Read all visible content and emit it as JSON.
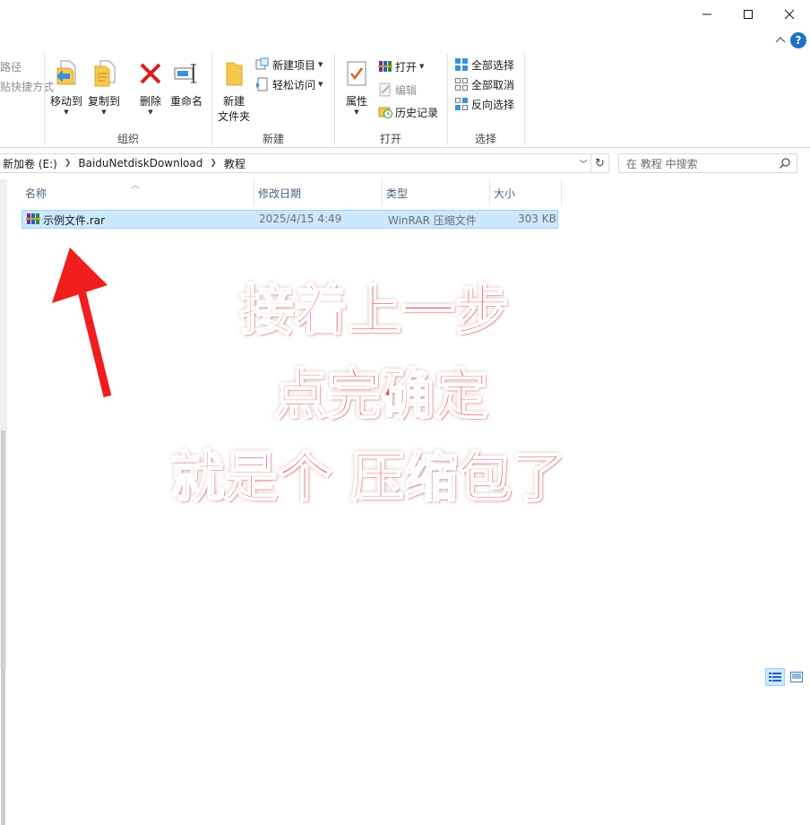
{
  "window": {
    "minimize": "minimize",
    "maximize": "maximize",
    "close": "close"
  },
  "ribbon": {
    "cut_partial_1": "路径",
    "cut_partial_2": "贴快捷方式",
    "organize": {
      "label": "组织",
      "move_to": "移动到",
      "copy_to": "复制到",
      "delete": "删除",
      "rename": "重命名"
    },
    "new": {
      "label": "新建",
      "new_folder_line1": "新建",
      "new_folder_line2": "文件夹",
      "new_item": "新建项目",
      "easy_access": "轻松访问"
    },
    "open": {
      "label": "打开",
      "properties": "属性",
      "open": "打开",
      "edit": "编辑",
      "history": "历史记录"
    },
    "select": {
      "label": "选择",
      "select_all": "全部选择",
      "select_none": "全部取消",
      "invert": "反向选择"
    }
  },
  "address": {
    "crumbs": [
      "新加卷 (E:)",
      "BaiduNetdiskDownload",
      "教程"
    ],
    "search_placeholder": "在 教程 中搜索"
  },
  "columns": {
    "name": "名称",
    "date": "修改日期",
    "type": "类型",
    "size": "大小"
  },
  "files": [
    {
      "name": "示例文件.rar",
      "date": "2025/4/15 4:49",
      "type": "WinRAR 压缩文件",
      "size": "303 KB"
    }
  ],
  "annotation": {
    "line1": "接着上一步",
    "line2": "点完确定",
    "line3": "就是个 压缩包了"
  },
  "colors": {
    "annotation": "#ef4656",
    "selection": "#cce8ff",
    "accent": "#0078d7"
  }
}
